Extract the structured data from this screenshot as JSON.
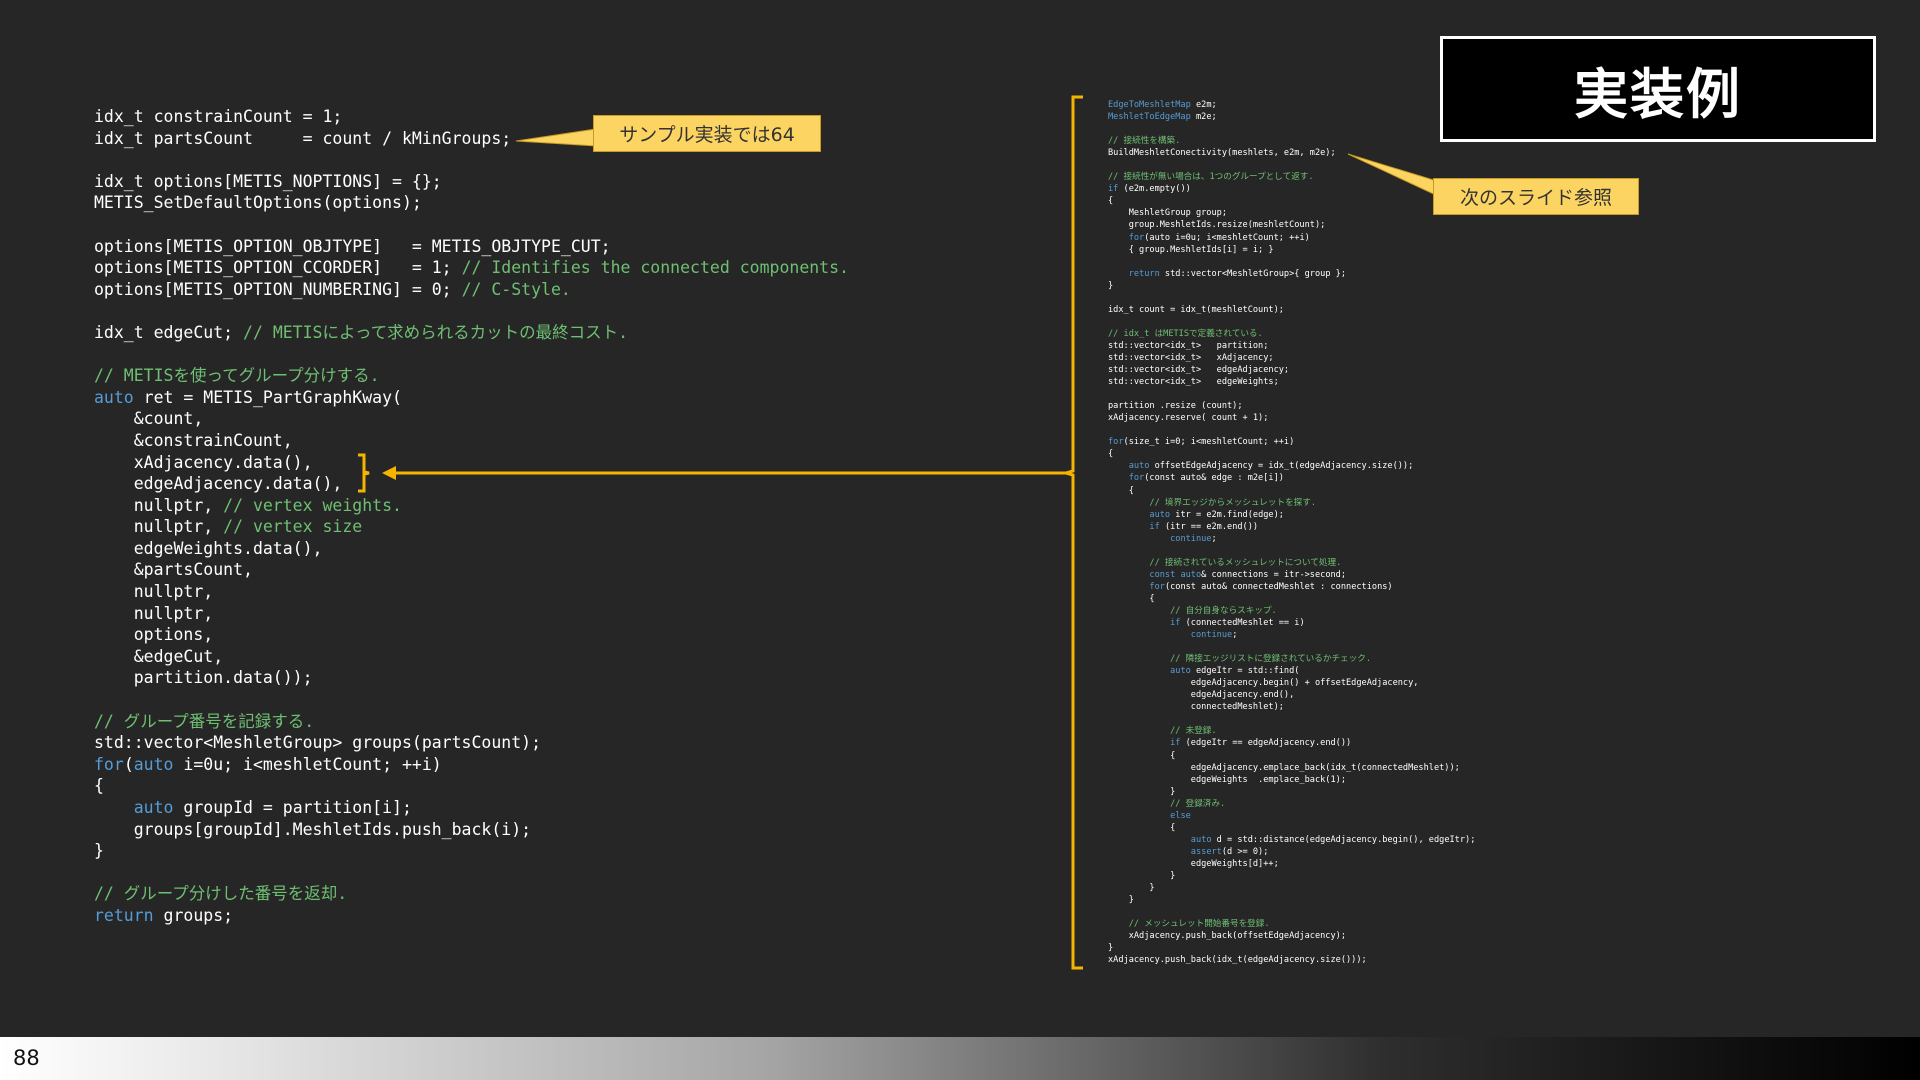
{
  "title": "実装例",
  "page_number": "88",
  "colors": {
    "keyword": "#569cd6",
    "comment": "#6fbf73",
    "callout": "#fcd462",
    "arrow": "#f5b400"
  },
  "callouts": {
    "sample": "サンプル実装では64",
    "next_slide": "次のスライド参照"
  },
  "main_code": [
    {
      "t": "idx_t constrainCount = 1;"
    },
    {
      "t": "idx_t partsCount     = count / kMinGroups;"
    },
    {
      "gap": true
    },
    {
      "t": "idx_t options[METIS_NOPTIONS] = {};"
    },
    {
      "t": "METIS_SetDefaultOptions(options);"
    },
    {
      "gap": true
    },
    {
      "t": "options[METIS_OPTION_OBJTYPE]   = METIS_OBJTYPE_CUT;"
    },
    {
      "t": "options[METIS_OPTION_CCORDER]   = 1; ",
      "c": "// Identifies the connected components."
    },
    {
      "t": "options[METIS_OPTION_NUMBERING] = 0; ",
      "c": "// C-Style."
    },
    {
      "gap": true
    },
    {
      "t": "idx_t edgeCut; ",
      "c": "// METISによって求められるカットの最終コスト."
    },
    {
      "gap": true
    },
    {
      "c": "// METISを使ってグループ分けする."
    },
    {
      "k": "auto",
      "t": " ret = METIS_PartGraphKway("
    },
    {
      "t": "    &count,"
    },
    {
      "t": "    &constrainCount,"
    },
    {
      "t": "    xAdjacency.data(),"
    },
    {
      "t": "    edgeAdjacency.data(),"
    },
    {
      "t": "    nullptr, ",
      "c": "// vertex weights."
    },
    {
      "t": "    nullptr, ",
      "c": "// vertex size"
    },
    {
      "t": "    edgeWeights.data(),"
    },
    {
      "t": "    &partsCount,"
    },
    {
      "t": "    nullptr,"
    },
    {
      "t": "    nullptr,"
    },
    {
      "t": "    options,"
    },
    {
      "t": "    &edgeCut,"
    },
    {
      "t": "    partition.data());"
    },
    {
      "gap": true
    },
    {
      "c": "// グループ番号を記録する."
    },
    {
      "t": "std::vector<MeshletGroup> groups(partsCount);"
    },
    {
      "k": "for",
      "t": "(",
      "k2": "auto",
      "t2": " i=0u; i<meshletCount; ++i)"
    },
    {
      "t": "{"
    },
    {
      "t": "    ",
      "k": "auto",
      "t2": " groupId = partition[i];"
    },
    {
      "t": "    groups[groupId].MeshletIds.push_back(i);"
    },
    {
      "t": "}"
    },
    {
      "gap": true
    },
    {
      "c": "// グループ分けした番号を返却."
    },
    {
      "k": "return",
      "t": " groups;"
    }
  ],
  "side_code": [
    {
      "k": "EdgeToMeshletMap",
      "t": " e2m;"
    },
    {
      "k": "MeshletToEdgeMap",
      "t": " m2e;"
    },
    {
      "t": ""
    },
    {
      "c": "// 接続性を構築."
    },
    {
      "t": "BuildMeshletConectivity(meshlets, e2m, m2e);"
    },
    {
      "t": ""
    },
    {
      "c": "// 接続性が無い場合は、1つのグループとして返す."
    },
    {
      "k": "if",
      "t": " (e2m.empty())"
    },
    {
      "t": "{"
    },
    {
      "t": "    MeshletGroup group;"
    },
    {
      "t": "    group.MeshletIds.resize(meshletCount);"
    },
    {
      "t": "    ",
      "k": "for",
      "t2": "(auto i=0u; i<meshletCount; ++i)"
    },
    {
      "t": "    { group.MeshletIds[i] = i; }"
    },
    {
      "t": ""
    },
    {
      "t": "    ",
      "k": "return",
      "t2": " std::vector<MeshletGroup>{ group };"
    },
    {
      "t": "}"
    },
    {
      "t": ""
    },
    {
      "t": "idx_t count = idx_t(meshletCount);"
    },
    {
      "t": ""
    },
    {
      "c": "// idx_t はMETISで定義されている."
    },
    {
      "t": "std::vector<idx_t>   partition;"
    },
    {
      "t": "std::vector<idx_t>   xAdjacency;"
    },
    {
      "t": "std::vector<idx_t>   edgeAdjacency;"
    },
    {
      "t": "std::vector<idx_t>   edgeWeights;"
    },
    {
      "t": ""
    },
    {
      "t": "partition .resize (count);"
    },
    {
      "t": "xAdjacency.reserve( count + 1);"
    },
    {
      "t": ""
    },
    {
      "k": "for",
      "t": "(size_t i=0; i<meshletCount; ++i)"
    },
    {
      "t": "{"
    },
    {
      "t": "    ",
      "k": "auto",
      "t2": " offsetEdgeAdjacency = idx_t(edgeAdjacency.size());"
    },
    {
      "t": "    ",
      "k": "for",
      "t2": "(const auto& edge : m2e[i])"
    },
    {
      "t": "    {"
    },
    {
      "t": "        ",
      "c": "// 境界エッジからメッシュレットを探す."
    },
    {
      "t": "        ",
      "k": "auto",
      "t2": " itr = e2m.find(edge);"
    },
    {
      "t": "        ",
      "k": "if",
      "t2": " (itr == e2m.end())"
    },
    {
      "t": "            ",
      "k": "continue",
      "t2": ";"
    },
    {
      "t": ""
    },
    {
      "t": "        ",
      "c": "// 接続されているメッシュレットについて処理."
    },
    {
      "t": "        ",
      "k": "const auto",
      "t2": "& connections = itr->second;"
    },
    {
      "t": "        ",
      "k": "for",
      "t2": "(const auto& connectedMeshlet : connections)"
    },
    {
      "t": "        {"
    },
    {
      "t": "            ",
      "c": "// 自分自身ならスキップ."
    },
    {
      "t": "            ",
      "k": "if",
      "t2": " (connectedMeshlet == i)"
    },
    {
      "t": "                ",
      "k": "continue",
      "t2": ";"
    },
    {
      "t": ""
    },
    {
      "t": "            ",
      "c": "// 隣接エッジリストに登録されているかチェック."
    },
    {
      "t": "            ",
      "k": "auto",
      "t2": " edgeItr = std::find("
    },
    {
      "t": "                edgeAdjacency.begin() + offsetEdgeAdjacency,"
    },
    {
      "t": "                edgeAdjacency.end(),"
    },
    {
      "t": "                connectedMeshlet);"
    },
    {
      "t": ""
    },
    {
      "t": "            ",
      "c": "// 未登録."
    },
    {
      "t": "            ",
      "k": "if",
      "t2": " (edgeItr == edgeAdjacency.end())"
    },
    {
      "t": "            {"
    },
    {
      "t": "                edgeAdjacency.emplace_back(idx_t(connectedMeshlet));"
    },
    {
      "t": "                edgeWeights  .emplace_back(1);"
    },
    {
      "t": "            }"
    },
    {
      "t": "            ",
      "c": "// 登録済み."
    },
    {
      "t": "            ",
      "k": "else",
      "t2": ""
    },
    {
      "t": "            {"
    },
    {
      "t": "                ",
      "k": "auto",
      "t2": " d = std::distance(edgeAdjacency.begin(), edgeItr);"
    },
    {
      "t": "                ",
      "k": "assert",
      "t2": "(d >= 0);"
    },
    {
      "t": "                edgeWeights[d]++;"
    },
    {
      "t": "            }"
    },
    {
      "t": "        }"
    },
    {
      "t": "    }"
    },
    {
      "t": ""
    },
    {
      "t": "    ",
      "c": "// メッシュレット開始番号を登録."
    },
    {
      "t": "    xAdjacency.push_back(offsetEdgeAdjacency);"
    },
    {
      "t": "}"
    },
    {
      "t": "xAdjacency.push_back(idx_t(edgeAdjacency.size()));"
    }
  ]
}
